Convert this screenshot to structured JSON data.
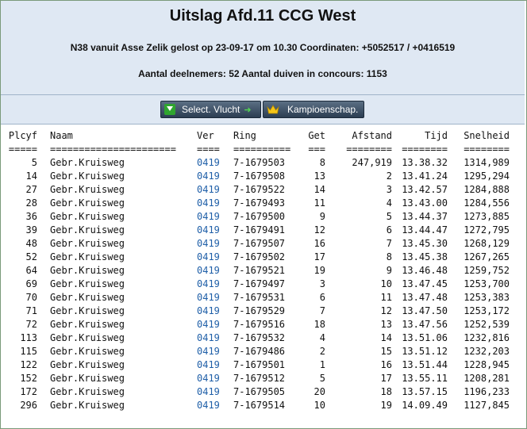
{
  "title": "Uitslag Afd.11 CCG West",
  "race_info": "N38 vanuit Asse Zelik gelost op 23-09-17 om 10.30 Coordinaten: +5052517 / +0416519",
  "participants_info": "Aantal deelnemers: 52 Aantal duiven in concours: 1153",
  "buttons": {
    "select_flight": "Select. Vlucht",
    "championship": "Kampioenschap."
  },
  "icons": {
    "select_flight": "download-icon",
    "select_flight_arrow": "arrow-right-icon",
    "championship": "crown-icon"
  },
  "colors": {
    "header_bg": "#dfe8f3",
    "button_bg": "#34475c",
    "ver_link": "#1f5fa8"
  },
  "table": {
    "headers": {
      "plcyf": "Plcyf",
      "naam": "Naam",
      "ver": "Ver",
      "ring": "Ring",
      "get": "Get",
      "afstand": "Afstand",
      "tijd": "Tijd",
      "snelheid": "Snelheid"
    },
    "separators": {
      "plcyf": "=====",
      "naam": "======================",
      "ver": "====",
      "ring": "==========",
      "get": "===",
      "afstand": "========",
      "tijd": "========",
      "snelheid": "========"
    },
    "rows": [
      {
        "plcyf": "5",
        "naam": "Gebr.Kruisweg",
        "ver": "0419",
        "ring": "7-1679503",
        "get": "8",
        "afstand": "247,919",
        "tijd": "13.38.32",
        "snelheid": "1314,989"
      },
      {
        "plcyf": "14",
        "naam": "Gebr.Kruisweg",
        "ver": "0419",
        "ring": "7-1679508",
        "get": "13",
        "afstand": "2",
        "tijd": "13.41.24",
        "snelheid": "1295,294"
      },
      {
        "plcyf": "27",
        "naam": "Gebr.Kruisweg",
        "ver": "0419",
        "ring": "7-1679522",
        "get": "14",
        "afstand": "3",
        "tijd": "13.42.57",
        "snelheid": "1284,888"
      },
      {
        "plcyf": "28",
        "naam": "Gebr.Kruisweg",
        "ver": "0419",
        "ring": "7-1679493",
        "get": "11",
        "afstand": "4",
        "tijd": "13.43.00",
        "snelheid": "1284,556"
      },
      {
        "plcyf": "36",
        "naam": "Gebr.Kruisweg",
        "ver": "0419",
        "ring": "7-1679500",
        "get": "9",
        "afstand": "5",
        "tijd": "13.44.37",
        "snelheid": "1273,885"
      },
      {
        "plcyf": "39",
        "naam": "Gebr.Kruisweg",
        "ver": "0419",
        "ring": "7-1679491",
        "get": "12",
        "afstand": "6",
        "tijd": "13.44.47",
        "snelheid": "1272,795"
      },
      {
        "plcyf": "48",
        "naam": "Gebr.Kruisweg",
        "ver": "0419",
        "ring": "7-1679507",
        "get": "16",
        "afstand": "7",
        "tijd": "13.45.30",
        "snelheid": "1268,129"
      },
      {
        "plcyf": "52",
        "naam": "Gebr.Kruisweg",
        "ver": "0419",
        "ring": "7-1679502",
        "get": "17",
        "afstand": "8",
        "tijd": "13.45.38",
        "snelheid": "1267,265"
      },
      {
        "plcyf": "64",
        "naam": "Gebr.Kruisweg",
        "ver": "0419",
        "ring": "7-1679521",
        "get": "19",
        "afstand": "9",
        "tijd": "13.46.48",
        "snelheid": "1259,752"
      },
      {
        "plcyf": "69",
        "naam": "Gebr.Kruisweg",
        "ver": "0419",
        "ring": "7-1679497",
        "get": "3",
        "afstand": "10",
        "tijd": "13.47.45",
        "snelheid": "1253,700"
      },
      {
        "plcyf": "70",
        "naam": "Gebr.Kruisweg",
        "ver": "0419",
        "ring": "7-1679531",
        "get": "6",
        "afstand": "11",
        "tijd": "13.47.48",
        "snelheid": "1253,383"
      },
      {
        "plcyf": "71",
        "naam": "Gebr.Kruisweg",
        "ver": "0419",
        "ring": "7-1679529",
        "get": "7",
        "afstand": "12",
        "tijd": "13.47.50",
        "snelheid": "1253,172"
      },
      {
        "plcyf": "72",
        "naam": "Gebr.Kruisweg",
        "ver": "0419",
        "ring": "7-1679516",
        "get": "18",
        "afstand": "13",
        "tijd": "13.47.56",
        "snelheid": "1252,539"
      },
      {
        "plcyf": "113",
        "naam": "Gebr.Kruisweg",
        "ver": "0419",
        "ring": "7-1679532",
        "get": "4",
        "afstand": "14",
        "tijd": "13.51.06",
        "snelheid": "1232,816"
      },
      {
        "plcyf": "115",
        "naam": "Gebr.Kruisweg",
        "ver": "0419",
        "ring": "7-1679486",
        "get": "2",
        "afstand": "15",
        "tijd": "13.51.12",
        "snelheid": "1232,203"
      },
      {
        "plcyf": "122",
        "naam": "Gebr.Kruisweg",
        "ver": "0419",
        "ring": "7-1679501",
        "get": "1",
        "afstand": "16",
        "tijd": "13.51.44",
        "snelheid": "1228,945"
      },
      {
        "plcyf": "152",
        "naam": "Gebr.Kruisweg",
        "ver": "0419",
        "ring": "7-1679512",
        "get": "5",
        "afstand": "17",
        "tijd": "13.55.11",
        "snelheid": "1208,281"
      },
      {
        "plcyf": "172",
        "naam": "Gebr.Kruisweg",
        "ver": "0419",
        "ring": "7-1679505",
        "get": "20",
        "afstand": "18",
        "tijd": "13.57.15",
        "snelheid": "1196,233"
      },
      {
        "plcyf": "296",
        "naam": "Gebr.Kruisweg",
        "ver": "0419",
        "ring": "7-1679514",
        "get": "10",
        "afstand": "19",
        "tijd": "14.09.49",
        "snelheid": "1127,845"
      }
    ]
  }
}
